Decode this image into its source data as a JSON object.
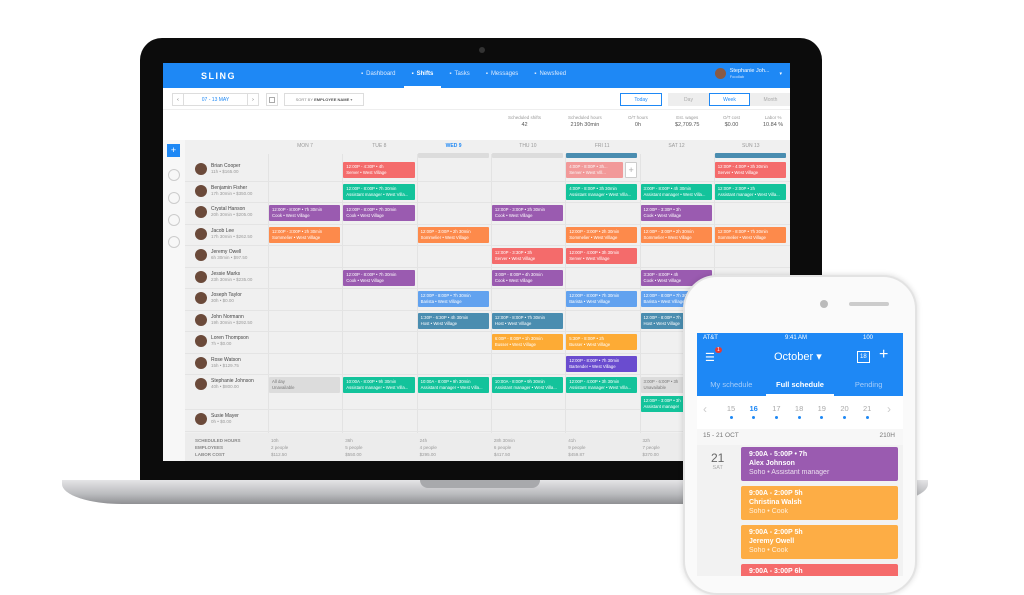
{
  "app": {
    "logo": "SLING",
    "nav": [
      {
        "icon": "dashboard-icon",
        "label": "Dashboard"
      },
      {
        "icon": "shifts-icon",
        "label": "Shifts",
        "active": true
      },
      {
        "icon": "tasks-icon",
        "label": "Tasks"
      },
      {
        "icon": "messages-icon",
        "label": "Messages"
      },
      {
        "icon": "newsfeed-icon",
        "label": "Newsfeed"
      }
    ],
    "user": {
      "name": "Stephanie Joh...",
      "org": "Foodlab"
    }
  },
  "toolbar": {
    "date_range": "07 - 13 MAY",
    "sort_label": "SORT BY",
    "sort_value": "EMPLOYEE NAME",
    "today": "Today",
    "views": [
      "Day",
      "Week",
      "Month"
    ],
    "active_view": "Week"
  },
  "stats": [
    {
      "label": "Scheduled shifts",
      "value": "42"
    },
    {
      "label": "Scheduled hours",
      "value": "219h 30min"
    },
    {
      "label": "O/T hours",
      "value": "0h"
    },
    {
      "label": "Est. wages",
      "value": "$2,709.75"
    },
    {
      "label": "O/T cost",
      "value": "$0.00"
    },
    {
      "label": "Labor %",
      "value": "10.84 %"
    }
  ],
  "days": [
    "MON 7",
    "TUE 8",
    "WED 9",
    "THU 10",
    "FRI 11",
    "SAT 12",
    "SUN 13"
  ],
  "today_index": 2,
  "colors": {
    "server": "#f46b6b",
    "asst": "#13c39b",
    "cook": "#9a5bb0",
    "somm": "#fd8a4b",
    "barista": "#62a2ef",
    "host": "#4a8db0",
    "busser": "#fdab35",
    "bartender": "#6a4ccf",
    "unavail": "#dcdcdc",
    "accent": "#1e88f5"
  },
  "employees": [
    {
      "name": "Brian Cooper",
      "sub": "11h • $165.00",
      "shifts": [
        [
          1,
          "12:00P - 4:30P • 4h",
          "Server • West Village",
          "server"
        ],
        [
          4,
          "4:00P - 8:00P • 3h...",
          "Server • West Vill...",
          "server"
        ],
        [
          6,
          "12:00P - 4:00P • 3h 30min",
          "Server • West Village",
          "server"
        ]
      ]
    },
    {
      "name": "Benjamin Fisher",
      "sub": "17h 30min • $350.00",
      "shifts": [
        [
          1,
          "12:00P - 8:00P • 7h 30min",
          "Assistant manager • West Villa...",
          "asst"
        ],
        [
          4,
          "4:00P - 8:00P • 3h 30min",
          "Assistant manager • West Villa...",
          "asst"
        ],
        [
          5,
          "3:00P - 8:00P • 4h 30min",
          "Assistant manager • West Villa...",
          "asst"
        ],
        [
          6,
          "12:00P - 2:00P • 2h",
          "Assistant manager • West Villa...",
          "asst"
        ]
      ]
    },
    {
      "name": "Crystal Hanson",
      "sub": "20h 30min • $205.00",
      "shifts": [
        [
          0,
          "12:00P - 8:00P • 7h 30min",
          "Cook • West Village",
          "cook"
        ],
        [
          1,
          "12:00P - 8:00P • 7h 30min",
          "Cook • West Village",
          "cook"
        ],
        [
          3,
          "12:00P - 3:00P • 2h 30min",
          "Cook • West Village",
          "cook"
        ],
        [
          5,
          "12:00P - 3:30P • 3h",
          "Cook • West Village",
          "cook"
        ]
      ]
    },
    {
      "name": "Jacob Lee",
      "sub": "17h 30min • $262.50",
      "shifts": [
        [
          0,
          "12:00P - 3:00P • 2h 30min",
          "Sommelier • West Village",
          "somm"
        ],
        [
          2,
          "12:00P - 3:00P • 2h 30min",
          "Sommelier • West Village",
          "somm"
        ],
        [
          4,
          "12:00P - 3:00P • 2h 30min",
          "Sommelier • West Village",
          "somm"
        ],
        [
          5,
          "12:00P - 3:00P • 2h 30min",
          "Sommelier • West Village",
          "somm"
        ],
        [
          6,
          "12:00P - 8:00P • 7h 30min",
          "Sommelier • West Village",
          "somm"
        ]
      ]
    },
    {
      "name": "Jeremy Owell",
      "sub": "6h 30min • $97.50",
      "shifts": [
        [
          3,
          "12:00P - 3:30P • 3h",
          "Server • West Village",
          "server"
        ],
        [
          4,
          "12:00P - 4:00P • 3h 30min",
          "Server • West Village",
          "server"
        ]
      ]
    },
    {
      "name": "Jessie Marks",
      "sub": "23h 30min • $235.00",
      "shifts": [
        [
          1,
          "12:00P - 8:00P • 7h 30min",
          "Cook • West Village",
          "cook"
        ],
        [
          3,
          "3:00P - 8:00P • 4h 30min",
          "Cook • West Village",
          "cook"
        ],
        [
          5,
          "3:30P - 8:00P • 4h",
          "Cook • West Village",
          "cook"
        ]
      ]
    },
    {
      "name": "Joseph Taylor",
      "sub": "30h • $0.00",
      "shifts": [
        [
          2,
          "12:00P - 8:00P • 7h 30min",
          "Barista • West Village",
          "barista"
        ],
        [
          4,
          "12:00P - 8:00P • 7h 30min",
          "Barista • West Village",
          "barista"
        ],
        [
          5,
          "12:00P - 8:00P • 7h 30min",
          "Barista • West Village",
          "barista"
        ]
      ]
    },
    {
      "name": "John Normann",
      "sub": "19h 30min • $292.50",
      "shifts": [
        [
          2,
          "1:30P - 6:30P • 4h 30min",
          "Host • West Village",
          "host"
        ],
        [
          3,
          "12:00P - 8:00P • 7h 30min",
          "Host • West Village",
          "host"
        ],
        [
          5,
          "12:00P - 8:00P • 7h",
          "Host • West Village",
          "host"
        ]
      ]
    },
    {
      "name": "Loren Thompson",
      "sub": "7h • $0.00",
      "shifts": [
        [
          3,
          "6:00P - 8:00P • 1h 30min",
          "Busser • West Village",
          "busser"
        ],
        [
          4,
          "5:30P - 8:00P • 2h",
          "Busser • West Village",
          "busser"
        ]
      ]
    },
    {
      "name": "Rose Watson",
      "sub": "15h • $129.75",
      "shifts": [
        [
          4,
          "12:00P - 8:00P • 7h 30min",
          "Bartender • West Village",
          "bartender"
        ]
      ]
    },
    {
      "name": "Stephanie Johnson",
      "sub": "40h • $800.00",
      "tall": true,
      "shifts": [
        [
          0,
          "All day",
          "Unavailable",
          "unavail"
        ],
        [
          1,
          "10:00A - 8:00P • 9h 30min",
          "Assistant manager • West Villa...",
          "asst"
        ],
        [
          2,
          "10:00A - 8:00P • 9h 30min",
          "Assistant manager • West Villa...",
          "asst"
        ],
        [
          3,
          "10:00A - 8:00P • 9h 30min",
          "Assistant manager • West Villa...",
          "asst"
        ],
        [
          4,
          "12:00P - 4:00P • 3h 30min",
          "Assistant manager • West Villa...",
          "asst"
        ],
        [
          5,
          "3:00P - 6:00P • 3h",
          "Unavailable",
          "unavail"
        ],
        [
          5,
          "12:00P - 3:00P • 3h",
          "Assistant manager",
          "asst",
          1
        ]
      ]
    },
    {
      "name": "Susie Mayer",
      "sub": "0h • $0.00",
      "shifts": []
    }
  ],
  "footer": {
    "labels": [
      "SCHEDULED HOURS",
      "EMPLOYEES",
      "LABOR COST"
    ],
    "cols": [
      [
        "10h",
        "2 people",
        "$112.50"
      ],
      [
        "36h",
        "5 people",
        "$550.00"
      ],
      [
        "24h",
        "4 people",
        "$295.00"
      ],
      [
        "28h 30min",
        "6 people",
        "$417.50"
      ],
      [
        "41h",
        "9 people",
        "$459.87"
      ],
      [
        "32h",
        "7 people",
        "$370.00"
      ]
    ]
  },
  "phone": {
    "carrier": "AT&T",
    "time": "9:41 AM",
    "battery": "100",
    "badge": "1",
    "month": "October",
    "calendar_day": "18",
    "tabs": [
      "My schedule",
      "Full schedule",
      "Pending"
    ],
    "active_tab": "Full schedule",
    "dates": [
      "15",
      "16",
      "17",
      "18",
      "19",
      "20",
      "21"
    ],
    "selected_date": "16",
    "range": "15 - 21 OCT",
    "range_hours": "210H",
    "day_num": "21",
    "day_name": "SAT",
    "cards": [
      {
        "time": "9:00A - 5:00P • 7h",
        "name": "Alex Johnson",
        "detail": "Soho • Assistant manager",
        "color": "#9a5bb0"
      },
      {
        "time": "9:00A - 2:00P 5h",
        "name": "Christina Walsh",
        "detail": "Soho • Cook",
        "color": "#fdad45"
      },
      {
        "time": "9:00A - 2:00P 5h",
        "name": "Jeremy Owell",
        "detail": "Soho • Cook",
        "color": "#fdad45"
      },
      {
        "time": "9:00A - 3:00P 6h",
        "name": "",
        "detail": "",
        "color": "#f56b6b"
      }
    ]
  }
}
